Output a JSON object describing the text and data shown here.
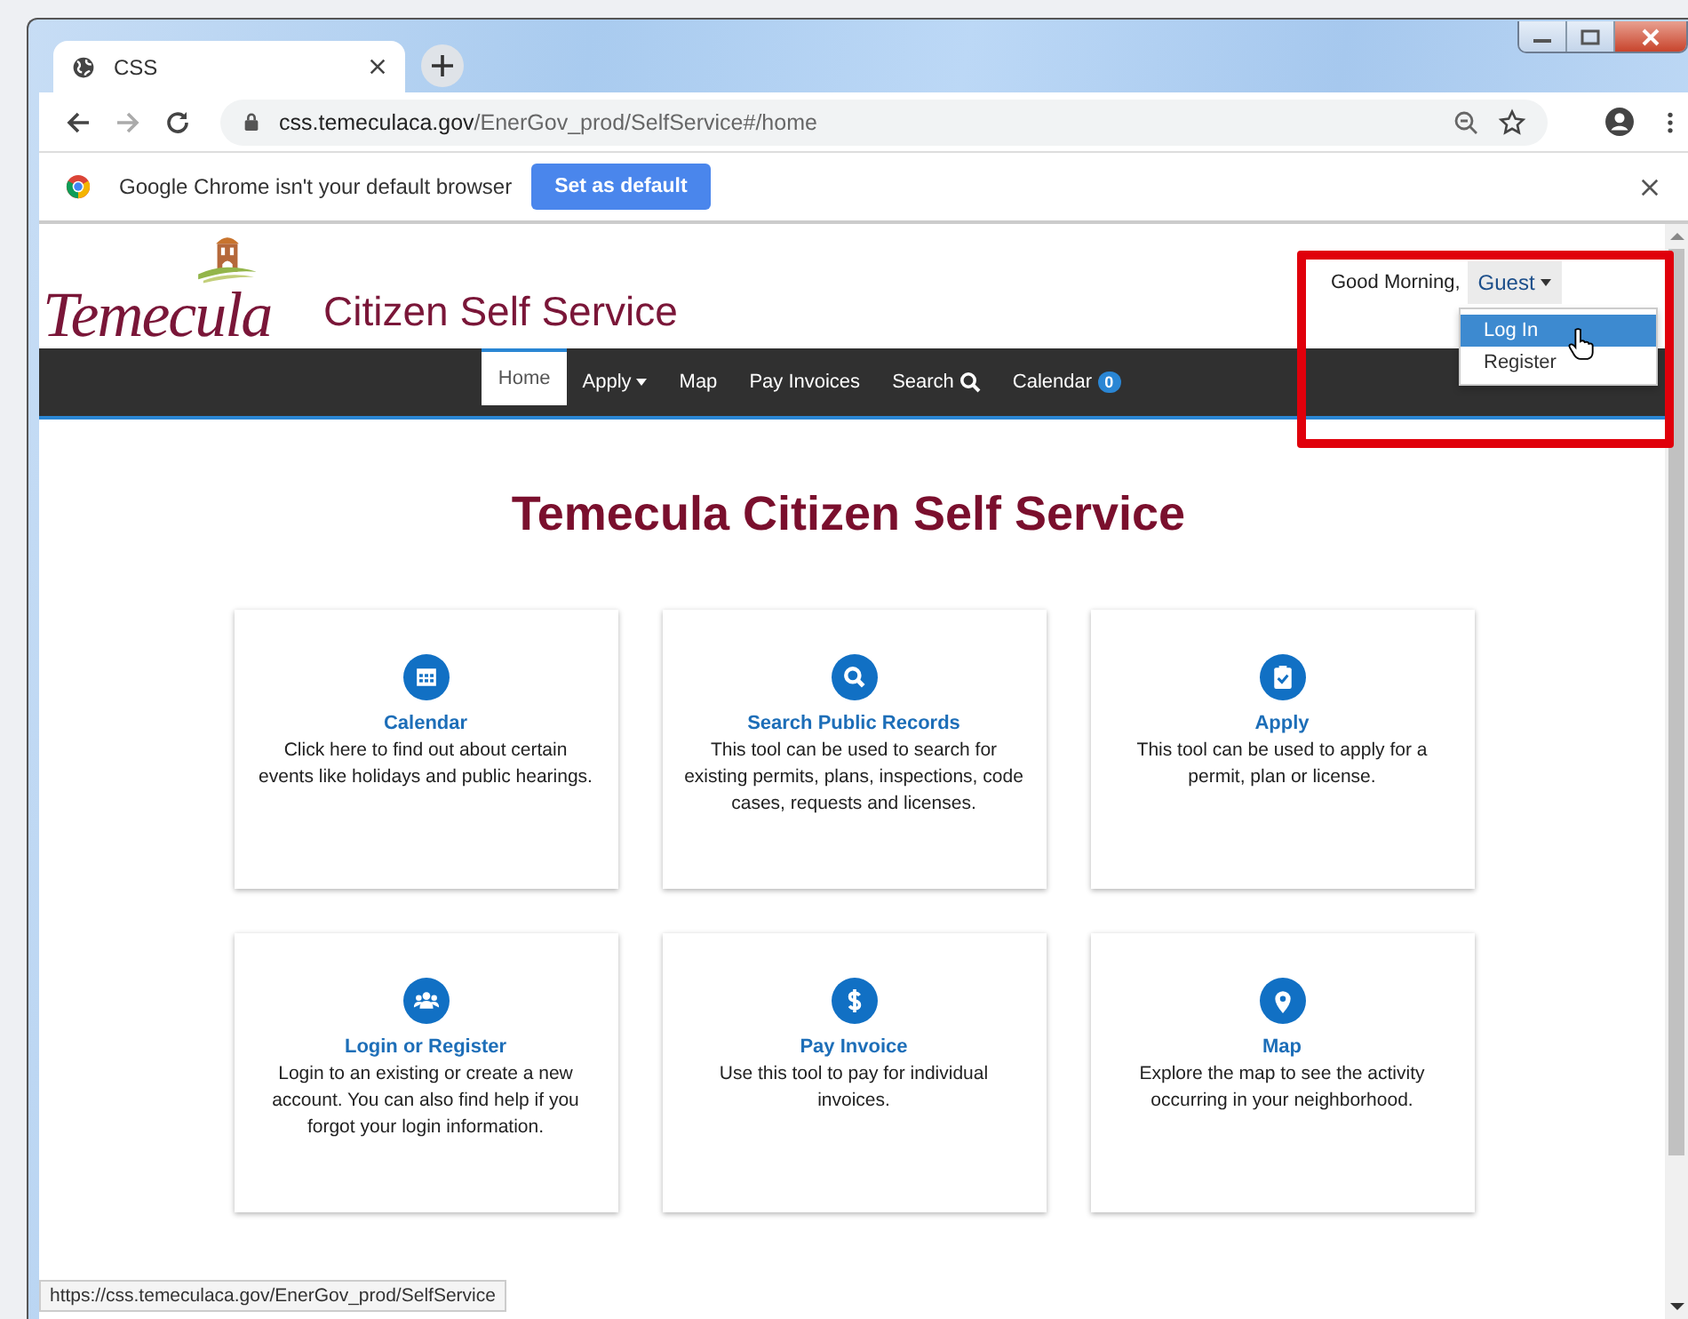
{
  "browser": {
    "tab": {
      "title": "CSS"
    },
    "address": {
      "domain": "css.temeculaca.gov",
      "path": "/EnerGov_prod/SelfService#/home"
    }
  },
  "infobar": {
    "message": "Google Chrome isn't your default browser",
    "button": "Set as default"
  },
  "header": {
    "logo_text": "Temecula",
    "site_title": "Citizen Self Service",
    "greeting": "Good Morning,",
    "user_menu": {
      "label": "Guest",
      "expanded": true,
      "items": [
        {
          "label": "Log In",
          "selected": true
        },
        {
          "label": "Register",
          "selected": false
        }
      ]
    }
  },
  "nav": [
    {
      "label": "Home",
      "kind": "link",
      "selected": true
    },
    {
      "label": "Apply",
      "kind": "dropdown",
      "selected": false
    },
    {
      "label": "Map",
      "kind": "link",
      "selected": false
    },
    {
      "label": "Pay Invoices",
      "kind": "link",
      "selected": false
    },
    {
      "label": "Search",
      "kind": "search",
      "selected": false
    },
    {
      "label": "Calendar",
      "kind": "badge",
      "badge": "0",
      "selected": false
    }
  ],
  "page_title": "Temecula Citizen Self Service",
  "cards": [
    {
      "kind": "calendar",
      "title": "Calendar",
      "description": "Click here to find out about certain events like holidays and public hearings."
    },
    {
      "kind": "search",
      "title": "Search Public Records",
      "description": "This tool can be used to search for existing permits, plans, inspections, code cases, requests and licenses."
    },
    {
      "kind": "apply",
      "title": "Apply",
      "description": "This tool can be used to apply for a permit, plan or license."
    },
    {
      "kind": "users",
      "title": "Login or Register",
      "description": "Login to an existing or create a new account. You can also find help if you forgot your login information."
    },
    {
      "kind": "pay",
      "title": "Pay Invoice",
      "description": "Use this tool to pay for individual invoices."
    },
    {
      "kind": "map",
      "title": "Map",
      "description": "Explore the map to see the activity occurring in your neighborhood."
    }
  ],
  "status_url": "https://css.temeculaca.gov/EnerGov_prod/SelfService"
}
